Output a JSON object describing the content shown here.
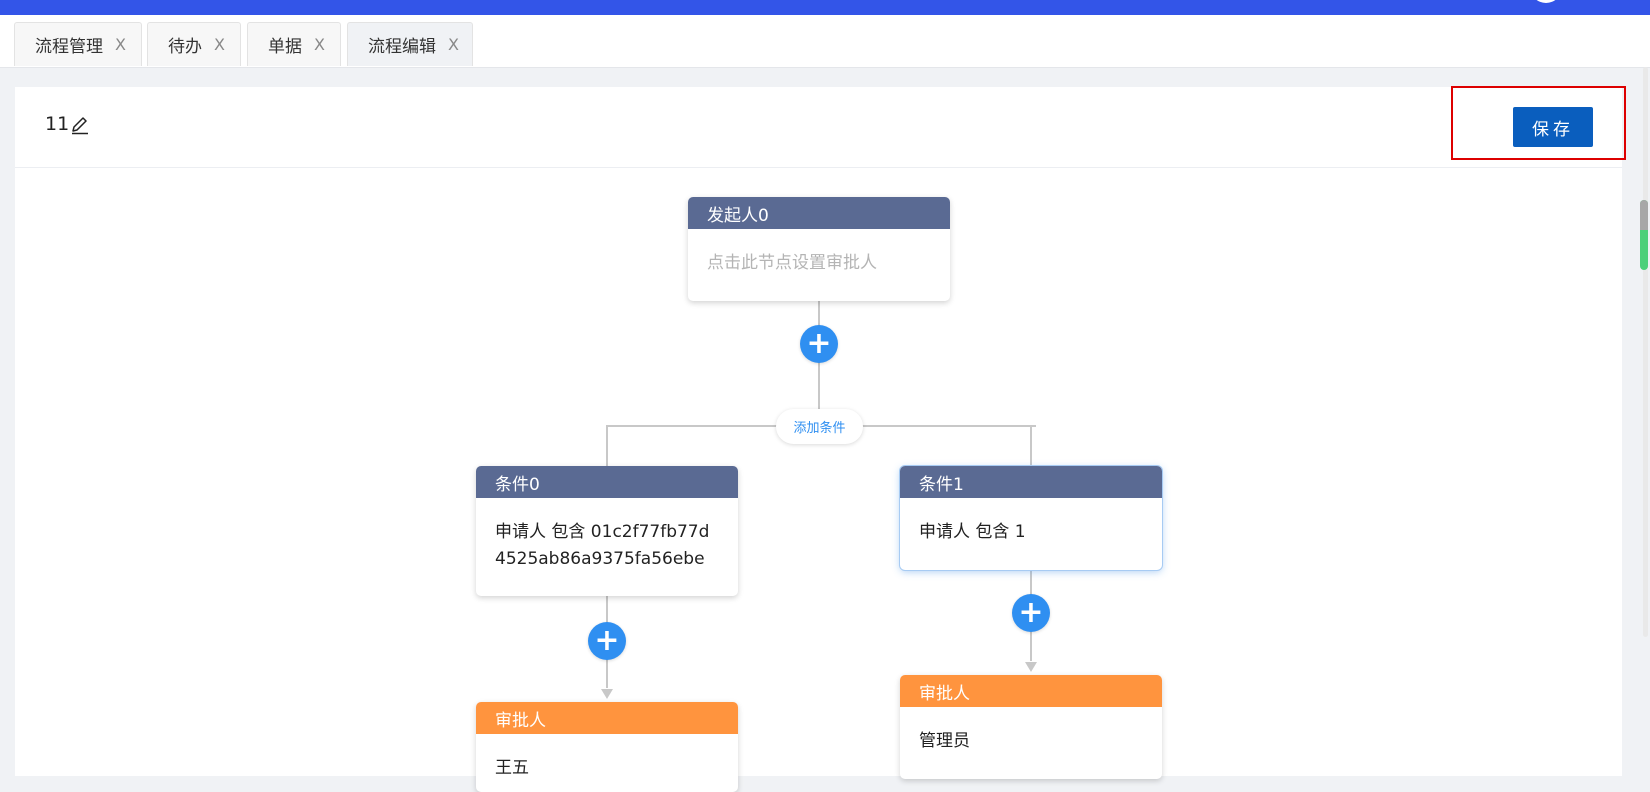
{
  "tabs": [
    {
      "label": "流程管理",
      "close": "X"
    },
    {
      "label": "待办",
      "close": "X"
    },
    {
      "label": "单据",
      "close": "X"
    },
    {
      "label": "流程编辑",
      "close": "X"
    }
  ],
  "header": {
    "title": "11",
    "save_label": "保存"
  },
  "flow": {
    "start": {
      "title": "发起人0",
      "body": "点击此节点设置审批人"
    },
    "add_condition_label": "添加条件",
    "add_icon": "+",
    "conditions": [
      {
        "title": "条件0",
        "body": "申请人 包含 01c2f77fb77d4525ab86a9375fa56ebe"
      },
      {
        "title": "条件1",
        "body": "申请人 包含 1"
      }
    ],
    "approvers": [
      {
        "title": "审批人",
        "body": "王五"
      },
      {
        "title": "审批人",
        "body": "管理员"
      }
    ]
  },
  "colors": {
    "topbar": "#3355e8",
    "primary": "#0a5ebe",
    "node_header": "#5a6a93",
    "approver_header": "#ff943e",
    "add_button": "#2f8ff1"
  }
}
